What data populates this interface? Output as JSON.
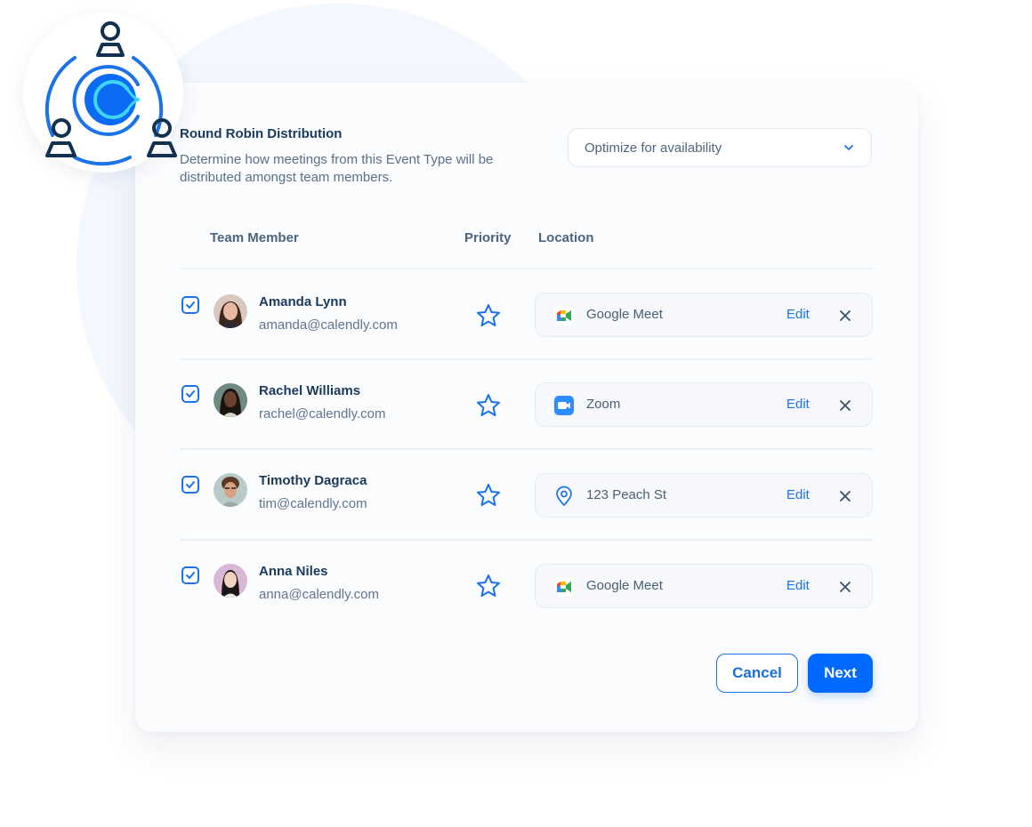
{
  "header": {
    "title": "Round Robin Distribution",
    "description": "Determine how meetings from this Event Type will be distributed amongst team members."
  },
  "distribution_select": {
    "value": "Optimize for availability",
    "icon": "chevron-down-icon"
  },
  "table": {
    "columns": [
      "Team Member",
      "Priority",
      "Location"
    ],
    "rows": [
      {
        "checked": true,
        "name": "Amanda Lynn",
        "email": "amanda@calendly.com",
        "priority_icon": "star-icon",
        "location": "Google Meet",
        "location_icon": "google-meet-icon",
        "edit": "Edit"
      },
      {
        "checked": true,
        "name": "Rachel Williams",
        "email": "rachel@calendly.com",
        "priority_icon": "star-icon",
        "location": "Zoom",
        "location_icon": "zoom-icon",
        "edit": "Edit"
      },
      {
        "checked": true,
        "name": "Timothy Dagraca",
        "email": "tim@calendly.com",
        "priority_icon": "star-icon",
        "location": "123 Peach St",
        "location_icon": "map-pin-icon",
        "edit": "Edit"
      },
      {
        "checked": true,
        "name": "Anna Niles",
        "email": "anna@calendly.com",
        "priority_icon": "star-icon",
        "location": "Google Meet",
        "location_icon": "google-meet-icon",
        "edit": "Edit"
      }
    ]
  },
  "actions": {
    "cancel": "Cancel",
    "next": "Next"
  },
  "colors": {
    "accent": "#0069ff",
    "link": "#1a73e8",
    "title": "#1a3a5c",
    "muted": "#5a6f88"
  }
}
